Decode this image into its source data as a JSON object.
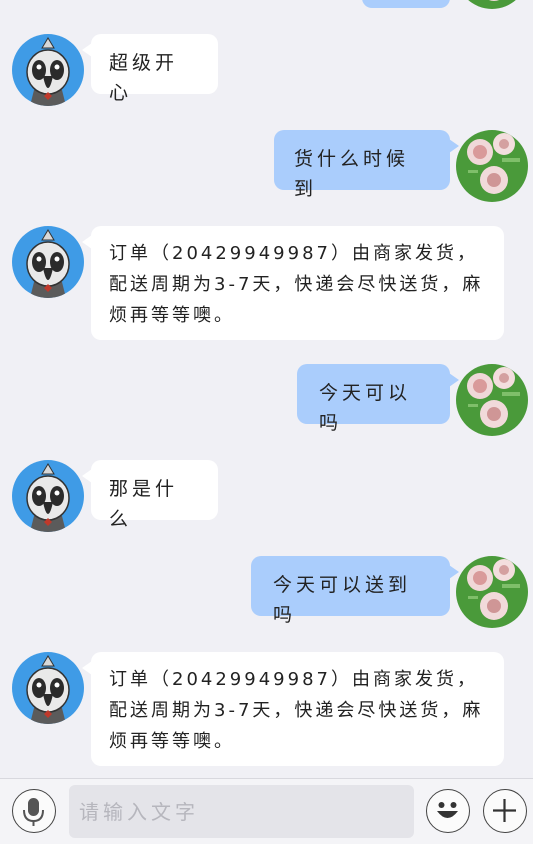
{
  "messages": [
    {
      "side": "right",
      "text": ""
    },
    {
      "side": "left",
      "text": "超级开心"
    },
    {
      "side": "right",
      "text": "货什么时候到"
    },
    {
      "side": "left",
      "text": "订单（20429949987）由商家发货，配送周期为3-7天，快递会尽快送货，麻烦再等等噢。"
    },
    {
      "side": "right",
      "text": "今天可以吗"
    },
    {
      "side": "left",
      "text": "那是什么"
    },
    {
      "side": "right",
      "text": "今天可以送到吗"
    },
    {
      "side": "left",
      "text": "订单（20429949987）由商家发货，配送周期为3-7天，快递会尽快送货，麻烦再等等噢。"
    }
  ],
  "input": {
    "placeholder": "请输入文字",
    "icons": {
      "voice": "microphone-icon",
      "emoji": "smiley-icon",
      "more": "plus-icon"
    }
  },
  "colors": {
    "background": "#f0f0f5",
    "bubble_self": "#aacdfc",
    "bubble_other": "#ffffff",
    "bot_avatar_bg": "#3f9be6",
    "user_avatar_bg": "#4a9a3a"
  }
}
